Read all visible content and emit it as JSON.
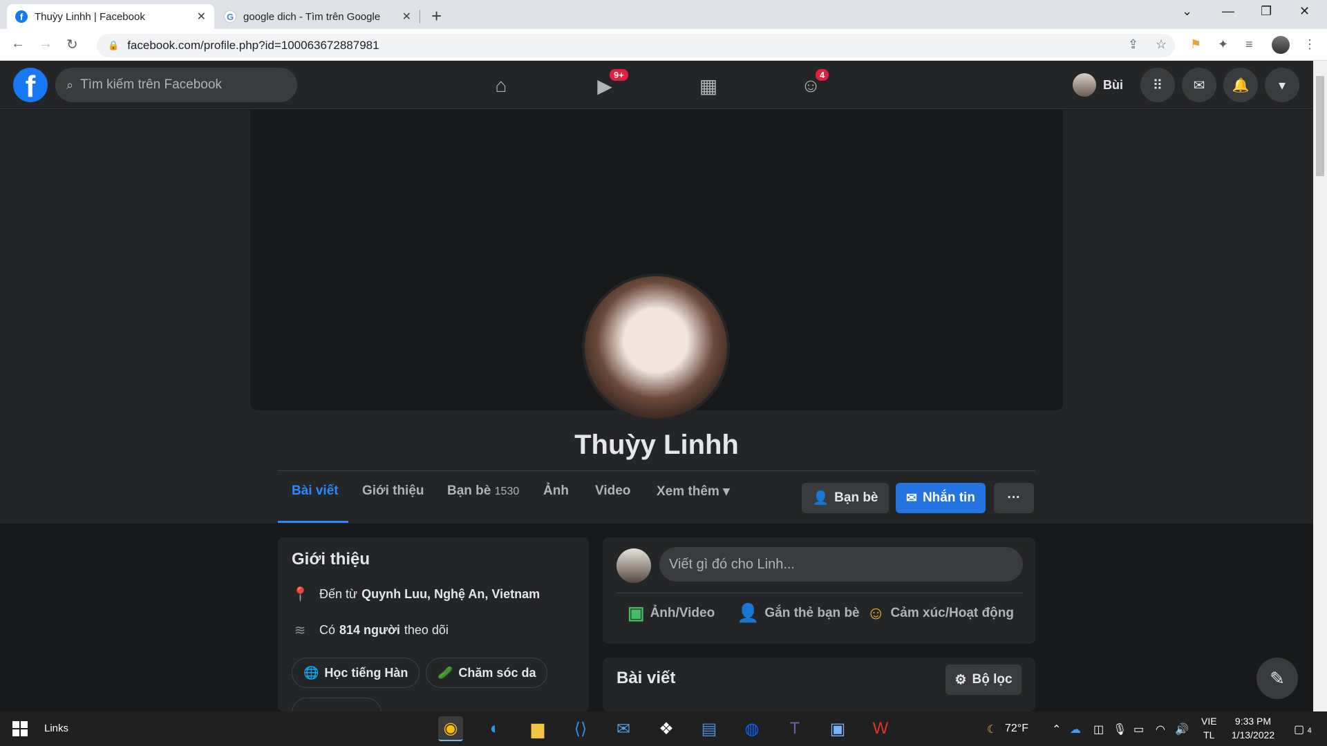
{
  "browser": {
    "tabs": [
      {
        "title": "Thuỳy Linhh | Facebook",
        "icon": "facebook-icon"
      },
      {
        "title": "google dich - Tìm trên Google",
        "icon": "google-icon"
      }
    ],
    "url": "facebook.com/profile.php?id=100063672887981"
  },
  "fb": {
    "search_placeholder": "Tìm kiếm trên Facebook",
    "logo": "f",
    "watch_badge": "9+",
    "groups_badge": "4",
    "user_name": "Bùi"
  },
  "profile": {
    "name": "Thuỳy Linhh",
    "tabs": {
      "posts": "Bài viết",
      "about": "Giới thiệu",
      "friends": "Bạn bè",
      "friends_count": "1530",
      "photos": "Ảnh",
      "videos": "Video",
      "more": "Xem thêm"
    },
    "friends_btn": "Bạn bè",
    "message_btn": "Nhắn tin",
    "more_btn": "···"
  },
  "intro": {
    "title": "Giới thiệu",
    "from_prefix": "Đến từ",
    "from_place": "Quynh Luu, Nghệ An, Vietnam",
    "followers_prefix": "Có",
    "followers_count": "814 người",
    "followers_suffix": "theo dõi",
    "hobbies": [
      "Học tiếng Hàn",
      "Chăm sóc da"
    ]
  },
  "composer": {
    "placeholder": "Viết gì đó cho Linh...",
    "photo_video": "Ảnh/Video",
    "tag_friends": "Gắn thẻ bạn bè",
    "feeling": "Cảm xúc/Hoạt động"
  },
  "posts": {
    "title": "Bài viết",
    "filter": "Bộ lọc"
  },
  "taskbar": {
    "links": "Links",
    "weather": "72°F",
    "lang_top": "VIE",
    "lang_bottom": "TL",
    "time": "9:33 PM",
    "date": "1/13/2022",
    "notif_count": "4"
  },
  "colors": {
    "fb_blue": "#1877f2",
    "accent": "#2d88ff",
    "badge_red": "#e41e3f"
  }
}
